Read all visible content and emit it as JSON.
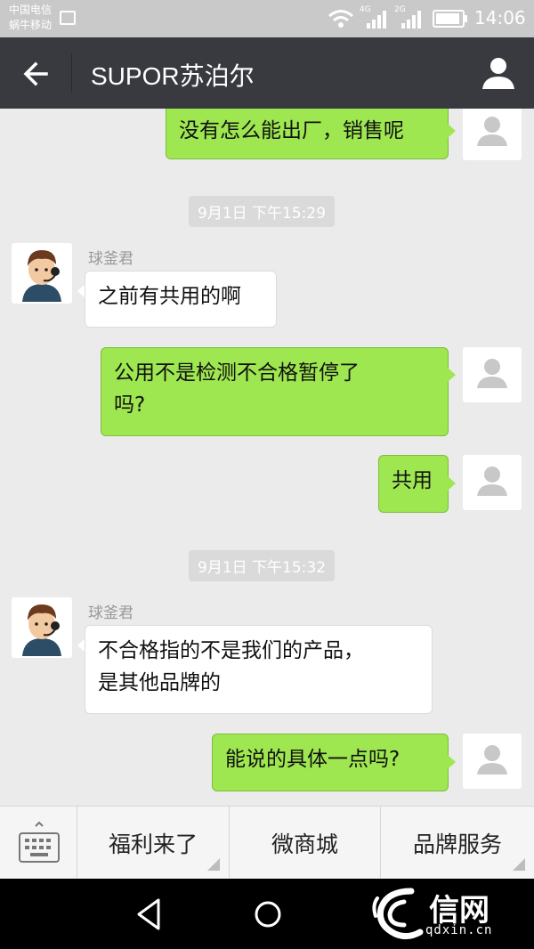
{
  "status_bar": {
    "carrier_1": "中国电信",
    "carrier_2": "蜗牛移动",
    "net_1": "4G",
    "net_2": "2G",
    "time": "14:06"
  },
  "header": {
    "title": "SUPOR苏泊尔",
    "back_icon": "arrow-left-icon",
    "profile_icon": "person-icon"
  },
  "messages": [
    {
      "side": "right",
      "text": "没有怎么能出厂，销售呢"
    },
    {
      "type": "timestamp",
      "text": "9月1日 下午15:29"
    },
    {
      "side": "left",
      "sender": "球釜君",
      "text": "之前有共用的啊"
    },
    {
      "side": "right",
      "lines": [
        "公用不是检测不合格暂停了",
        "吗?"
      ]
    },
    {
      "side": "right",
      "text": "共用"
    },
    {
      "type": "timestamp",
      "text": "9月1日 下午15:32"
    },
    {
      "side": "left",
      "sender": "球釜君",
      "lines": [
        "不合格指的不是我们的产品，",
        "是其他品牌的"
      ]
    },
    {
      "side": "right",
      "text": "能说的具体一点吗?"
    }
  ],
  "menu": {
    "keyboard_icon": "keyboard-icon",
    "items": [
      "福利来了",
      "微商城",
      "品牌服务"
    ]
  },
  "watermark": {
    "text": "信网",
    "url": "qdxin.cn"
  },
  "colors": {
    "outgoing_bubble": "#9ee750",
    "incoming_bubble": "#ffffff",
    "title_bar": "#393a3f",
    "chat_background": "#ebebeb"
  }
}
